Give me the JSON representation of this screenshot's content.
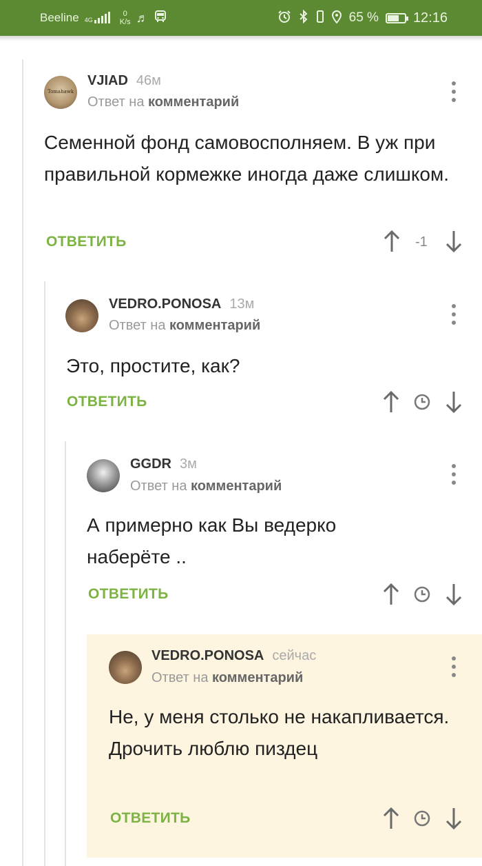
{
  "status_bar": {
    "carrier": "Beeline",
    "network": "4G",
    "speed_value": "0",
    "speed_unit": "K/s",
    "battery_percent": "65 %",
    "battery_level": 0.65,
    "time": "12:16",
    "bar_color": "#5b8a32"
  },
  "accent_color": "#7cb342",
  "comments": [
    {
      "author": "VJIAD",
      "time_ago": "46м",
      "reply_prefix": "Ответ на",
      "reply_link": "комментарий",
      "text": "Семенной фонд самовосполняем. В уж при правильной кормежке иногда даже слишком.",
      "reply_label": "ОТВЕТИТЬ",
      "score": "-1",
      "avatar_text": "Tomahawk"
    },
    {
      "author": "VEDRO.PONOSA",
      "time_ago": "13м",
      "reply_prefix": "Ответ на",
      "reply_link": "комментарий",
      "text": "Это, простите, как?",
      "reply_label": "ОТВЕТИТЬ"
    },
    {
      "author": "GGDR",
      "time_ago": "3м",
      "reply_prefix": "Ответ на",
      "reply_link": "комментарий",
      "text": "А примерно как Вы ведерко наберёте ..",
      "reply_label": "ОТВЕТИТЬ"
    },
    {
      "author": "VEDRO.PONOSA",
      "time_ago": "сейчас",
      "reply_prefix": "Ответ на",
      "reply_link": "комментарий",
      "text": "Не, у меня столько не накапливается. Дрочить люблю пиздец",
      "reply_label": "ОТВЕТИТЬ"
    }
  ]
}
